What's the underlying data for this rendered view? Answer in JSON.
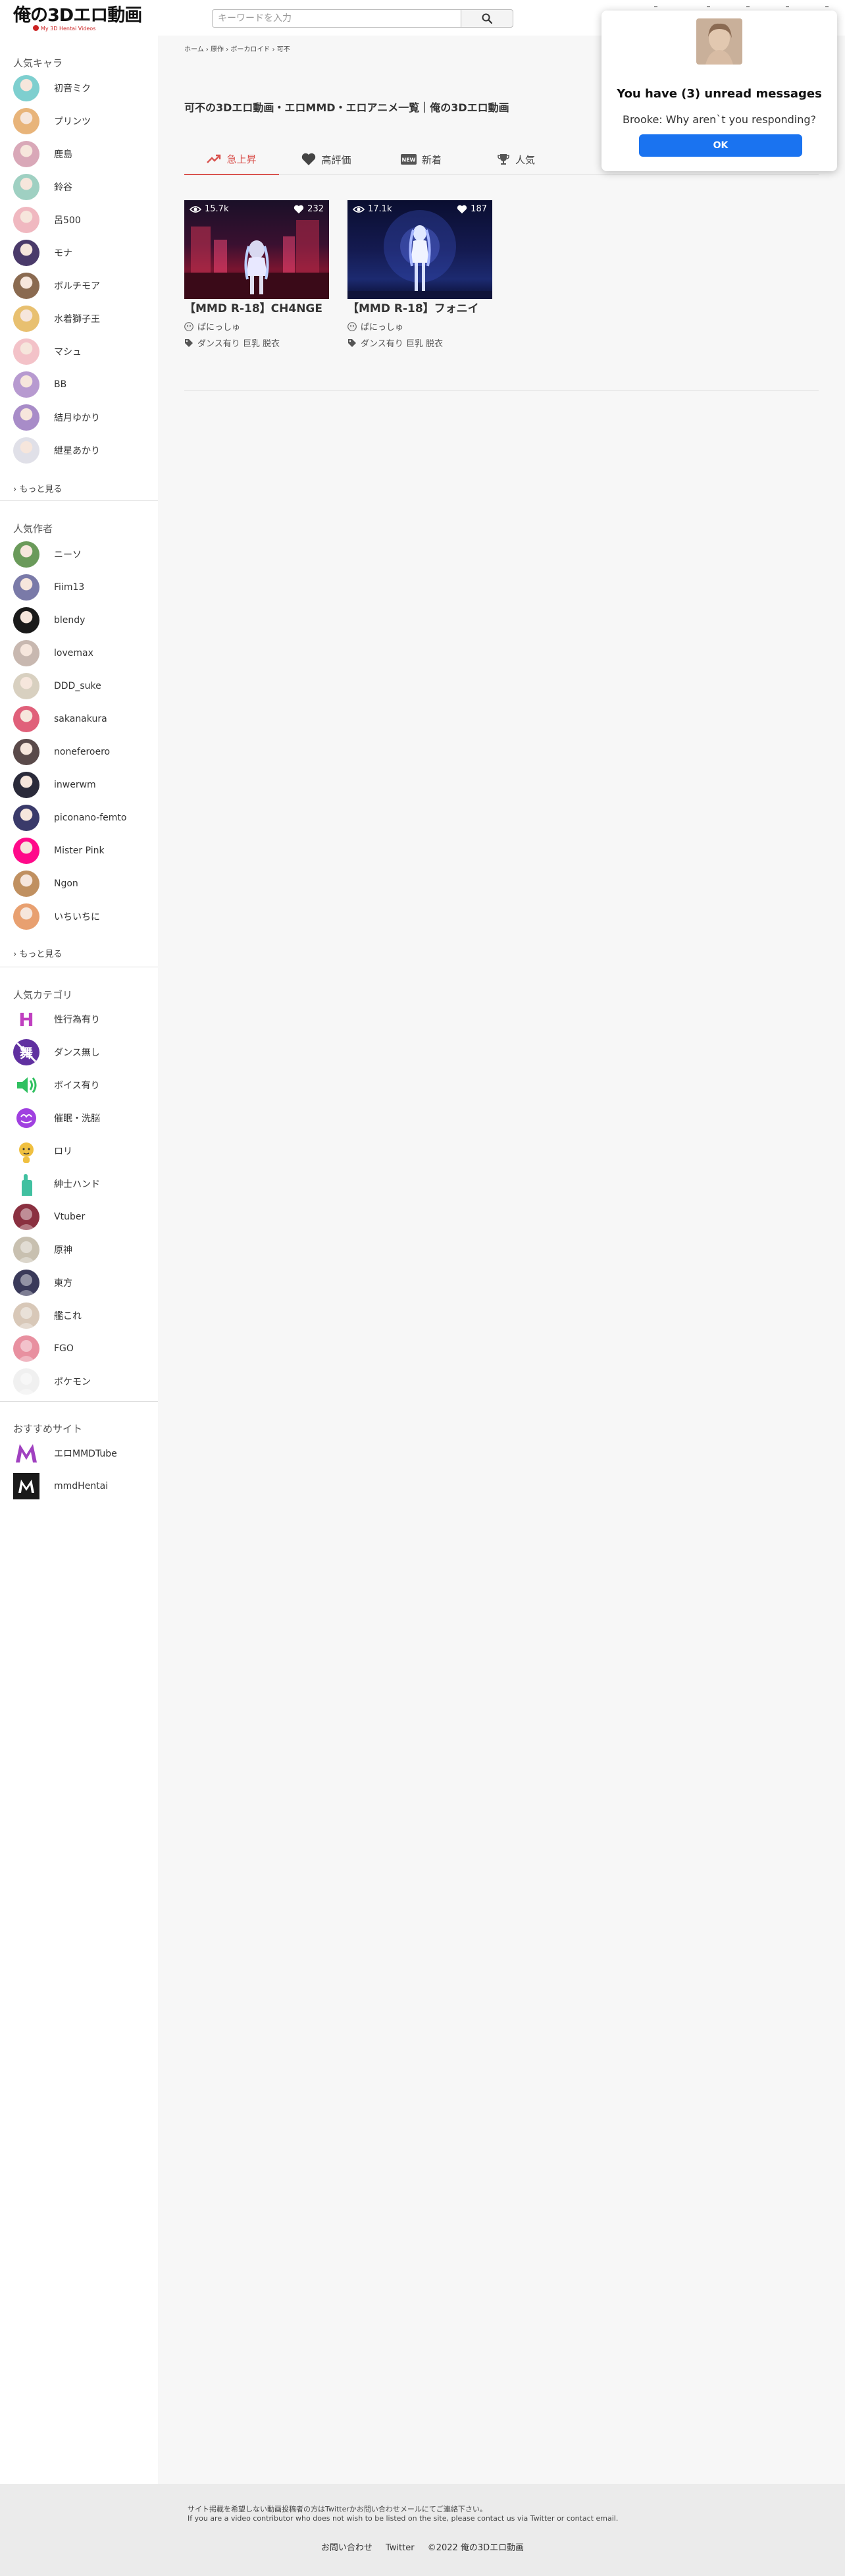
{
  "header": {
    "logo_text": "俺の3Dエロ動画",
    "logo_sub": "My 3D Hentai Videos",
    "search_placeholder": "キーワードを入力"
  },
  "sidebar": {
    "characters_title": "人気キャラ",
    "characters": [
      {
        "label": "初音ミク",
        "color": "#7ecfcf"
      },
      {
        "label": "プリンツ",
        "color": "#e8b47a"
      },
      {
        "label": "鹿島",
        "color": "#d9a8b8"
      },
      {
        "label": "鈴谷",
        "color": "#9fd0c2"
      },
      {
        "label": "呂500",
        "color": "#f0b8c0"
      },
      {
        "label": "モナ",
        "color": "#4a3a6a"
      },
      {
        "label": "ボルチモア",
        "color": "#8a6a50"
      },
      {
        "label": "水着獅子王",
        "color": "#e8c070"
      },
      {
        "label": "マシュ",
        "color": "#f3c2c8"
      },
      {
        "label": "BB",
        "color": "#b79ad0"
      },
      {
        "label": "結月ゆかり",
        "color": "#a88cc8"
      },
      {
        "label": "紲星あかり",
        "color": "#e0e0e8"
      }
    ],
    "characters_more": "もっと見る",
    "authors_title": "人気作者",
    "authors": [
      {
        "label": "ニーソ",
        "color": "#6a9a5a"
      },
      {
        "label": "Fiim13",
        "color": "#7a7aa8"
      },
      {
        "label": "blendy",
        "color": "#1a1a1a"
      },
      {
        "label": "lovemax",
        "color": "#c8b8b0"
      },
      {
        "label": "DDD_suke",
        "color": "#d8d0c0"
      },
      {
        "label": "sakanakura",
        "color": "#e0607a"
      },
      {
        "label": "noneferoero",
        "color": "#5a4a4a"
      },
      {
        "label": "inwerwm",
        "color": "#2a2a3a"
      },
      {
        "label": "piconano-femto",
        "color": "#3a3a6a"
      },
      {
        "label": "Mister Pink",
        "color": "#ff0a8a"
      },
      {
        "label": "Ngon",
        "color": "#c09060"
      },
      {
        "label": "いちいちに",
        "color": "#e8a070"
      }
    ],
    "authors_more": "もっと見る",
    "categories_title": "人気カテゴリ",
    "categories": [
      {
        "label": "性行為有り",
        "color": "#c040c0",
        "icon": "letter-h-icon"
      },
      {
        "label": "ダンス無し",
        "color": "#6030a0",
        "icon": "no-dance-icon"
      },
      {
        "label": "ボイス有り",
        "color": "#30c060",
        "icon": "speaker-icon"
      },
      {
        "label": "催眠・洗脳",
        "color": "#a040e0",
        "icon": "brain-icon"
      },
      {
        "label": "ロリ",
        "color": "#f0c040",
        "icon": "baby-icon"
      },
      {
        "label": "紳士ハンド",
        "color": "#40c0a0",
        "icon": "hand-icon"
      },
      {
        "label": "Vtuber",
        "color": "#8a3040",
        "icon": "vtuber-icon"
      },
      {
        "label": "原神",
        "color": "#c8c0b0",
        "icon": "genshin-icon"
      },
      {
        "label": "東方",
        "color": "#3a3a5a",
        "icon": "touhou-icon"
      },
      {
        "label": "艦これ",
        "color": "#d8c8b8",
        "icon": "kancolle-icon"
      },
      {
        "label": "FGO",
        "color": "#e890a0",
        "icon": "fgo-icon"
      },
      {
        "label": "ポケモン",
        "color": "#f0f0f0",
        "icon": "pokemon-icon"
      }
    ],
    "sites_title": "おすすめサイト",
    "sites": [
      {
        "label": "エロMMDTube",
        "color": "#a040c0",
        "icon": "m-logo-icon"
      },
      {
        "label": "mmdHentai",
        "color": "#1a1a1a",
        "icon": "m-logo-dark-icon"
      }
    ]
  },
  "main": {
    "breadcrumb": "ホーム › 原作 › ボーカロイド › 可不",
    "title": "可不の3Dエロ動画・エロMMD・エロアニメ一覧｜俺の3Dエロ動画",
    "tabs": [
      {
        "label": "急上昇",
        "icon": "trending-icon"
      },
      {
        "label": "高評価",
        "icon": "heart-icon"
      },
      {
        "label": "新着",
        "icon": "new-icon"
      },
      {
        "label": "人気",
        "icon": "trophy-icon"
      }
    ],
    "videos": [
      {
        "views": "15.7k",
        "likes": "232",
        "title": "【MMD R-18】CH4NGE",
        "author": "ぱにっしゅ",
        "tags": "ダンス有り 巨乳 脱衣"
      },
      {
        "views": "17.1k",
        "likes": "187",
        "title": "【MMD R-18】フォニイ",
        "author": "ぱにっしゅ",
        "tags": "ダンス有り 巨乳 脱衣"
      }
    ]
  },
  "footer": {
    "note_ja": "サイト掲載を希望しない動画投稿者の方はTwitterかお問い合わせメールにてご連絡下さい。",
    "note_en": "If you are a video contributor who does not wish to be listed on the site, please contact us via Twitter or contact email.",
    "contact": "お問い合わせ",
    "twitter": "Twitter",
    "copyright": "©2022 俺の3Dエロ動画"
  },
  "popup": {
    "title": "You have (3) unread messages",
    "message": "Brooke: Why aren`t you responding?",
    "ok_label": "OK"
  },
  "colors": {
    "accent": "#d9534f",
    "popup_button": "#1a73f0"
  }
}
